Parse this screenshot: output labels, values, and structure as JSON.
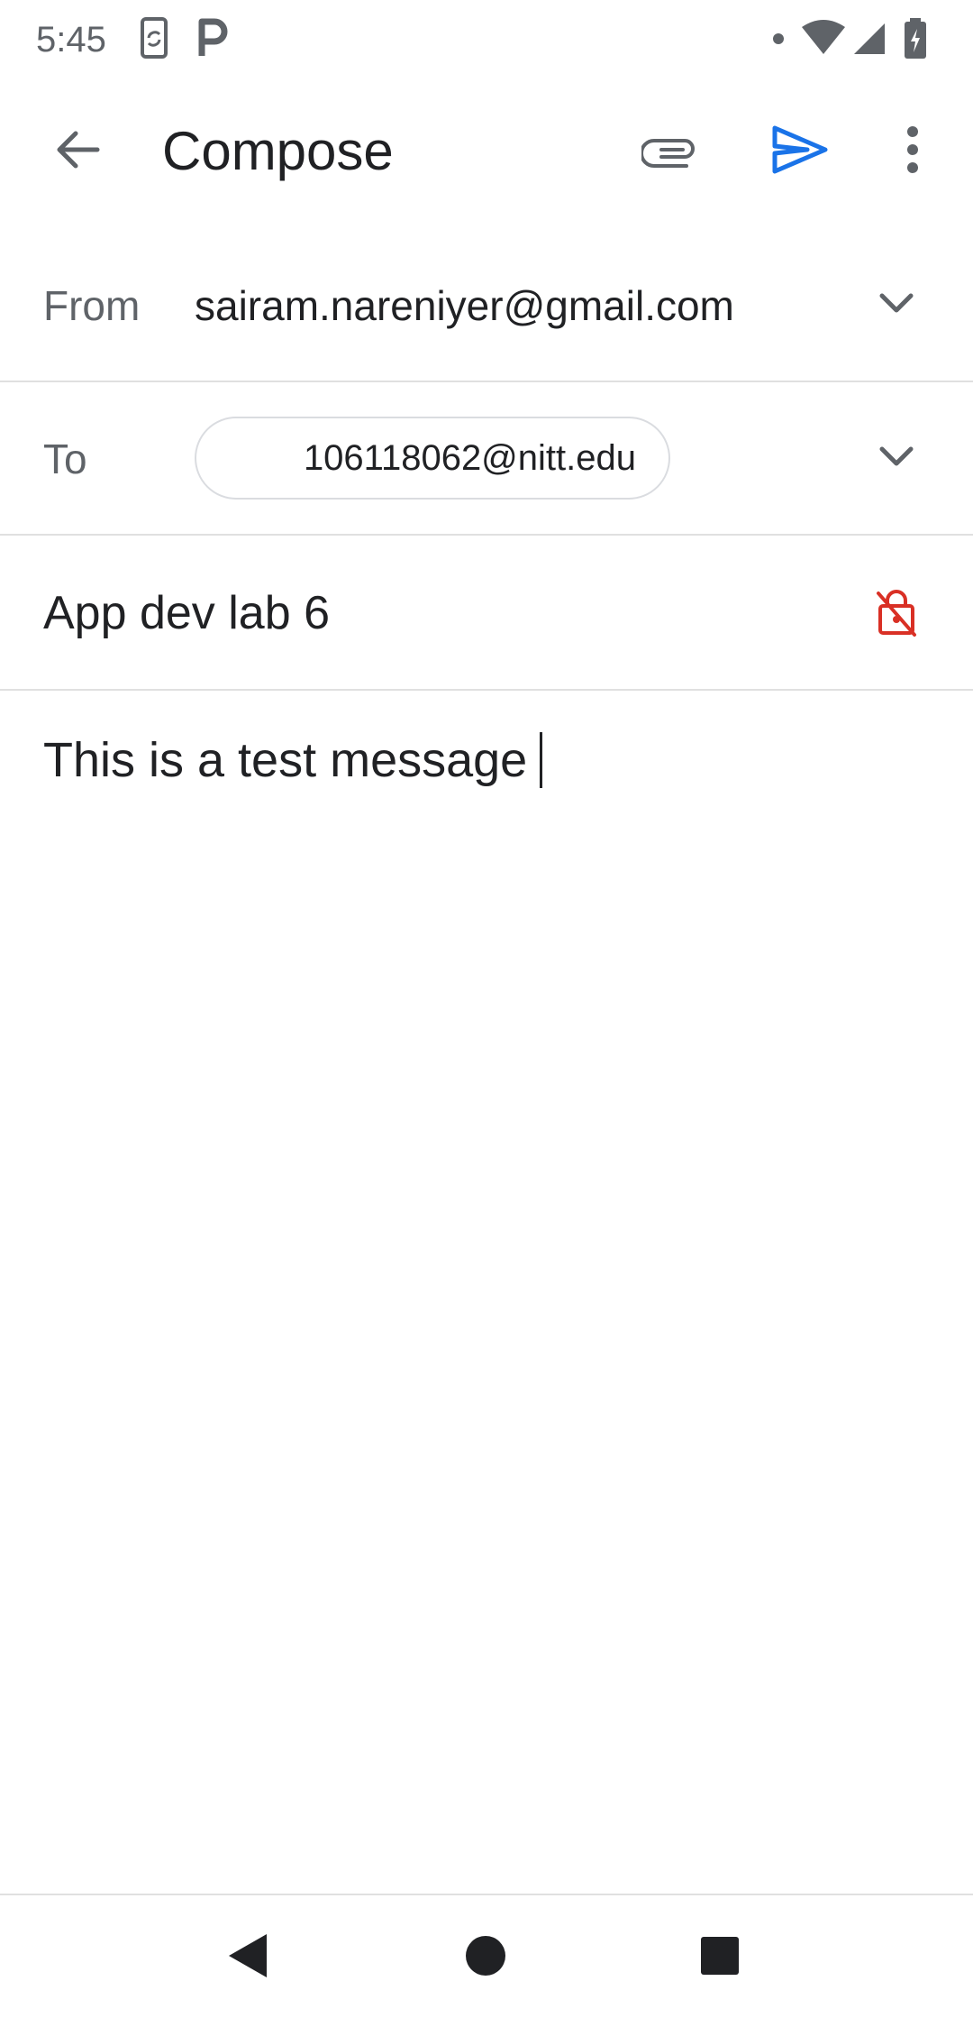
{
  "status_bar": {
    "time": "5:45",
    "icons": [
      "phone-sync-icon",
      "parking-app-icon",
      "notification-dot-icon",
      "wifi-icon",
      "signal-icon",
      "battery-charging-icon"
    ]
  },
  "app_bar": {
    "title": "Compose",
    "icons": [
      "back-arrow-icon",
      "attach-icon",
      "send-icon",
      "more-vert-icon"
    ],
    "accent_color": "#1a73e8"
  },
  "compose": {
    "from_label": "From",
    "from_value": "sairam.nareniyer@gmail.com",
    "to_label": "To",
    "to_chip": "106118062@nitt.edu",
    "subject": "App dev lab 6",
    "body": "This is a test message",
    "lock_icon_color": "#d93025"
  },
  "nav_bar": {
    "icons": [
      "nav-back-icon",
      "nav-home-icon",
      "nav-recents-icon"
    ]
  }
}
